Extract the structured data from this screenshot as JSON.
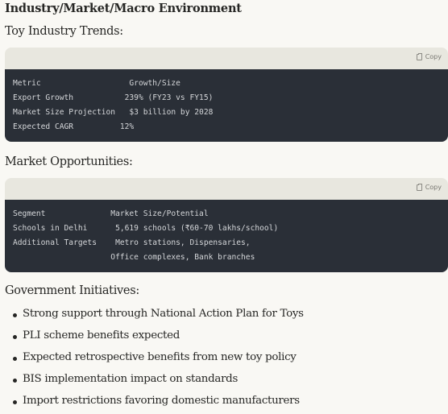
{
  "section_title": "Industry/Market/Macro Environment",
  "toy_trends": {
    "heading": "Toy Industry Trends:",
    "copy_label": "Copy",
    "lines": [
      "Metric                   Growth/Size",
      "Export Growth           239% (FY23 vs FY15)",
      "Market Size Projection   $3 billion by 2028",
      "Expected CAGR          12%"
    ]
  },
  "market_opportunities": {
    "heading": "Market Opportunities:",
    "copy_label": "Copy",
    "lines": [
      "Segment              Market Size/Potential",
      "Schools in Delhi      5,619 schools (₹60-70 lakhs/school)",
      "Additional Targets    Metro stations, Dispensaries,",
      "                     Office complexes, Bank branches"
    ]
  },
  "government": {
    "heading": "Government Initiatives:",
    "items": [
      "Strong support through National Action Plan for Toys",
      "PLI scheme benefits expected",
      "Expected retrospective benefits from new toy policy",
      "BIS implementation impact on standards",
      "Import restrictions favoring domestic manufacturers"
    ]
  }
}
